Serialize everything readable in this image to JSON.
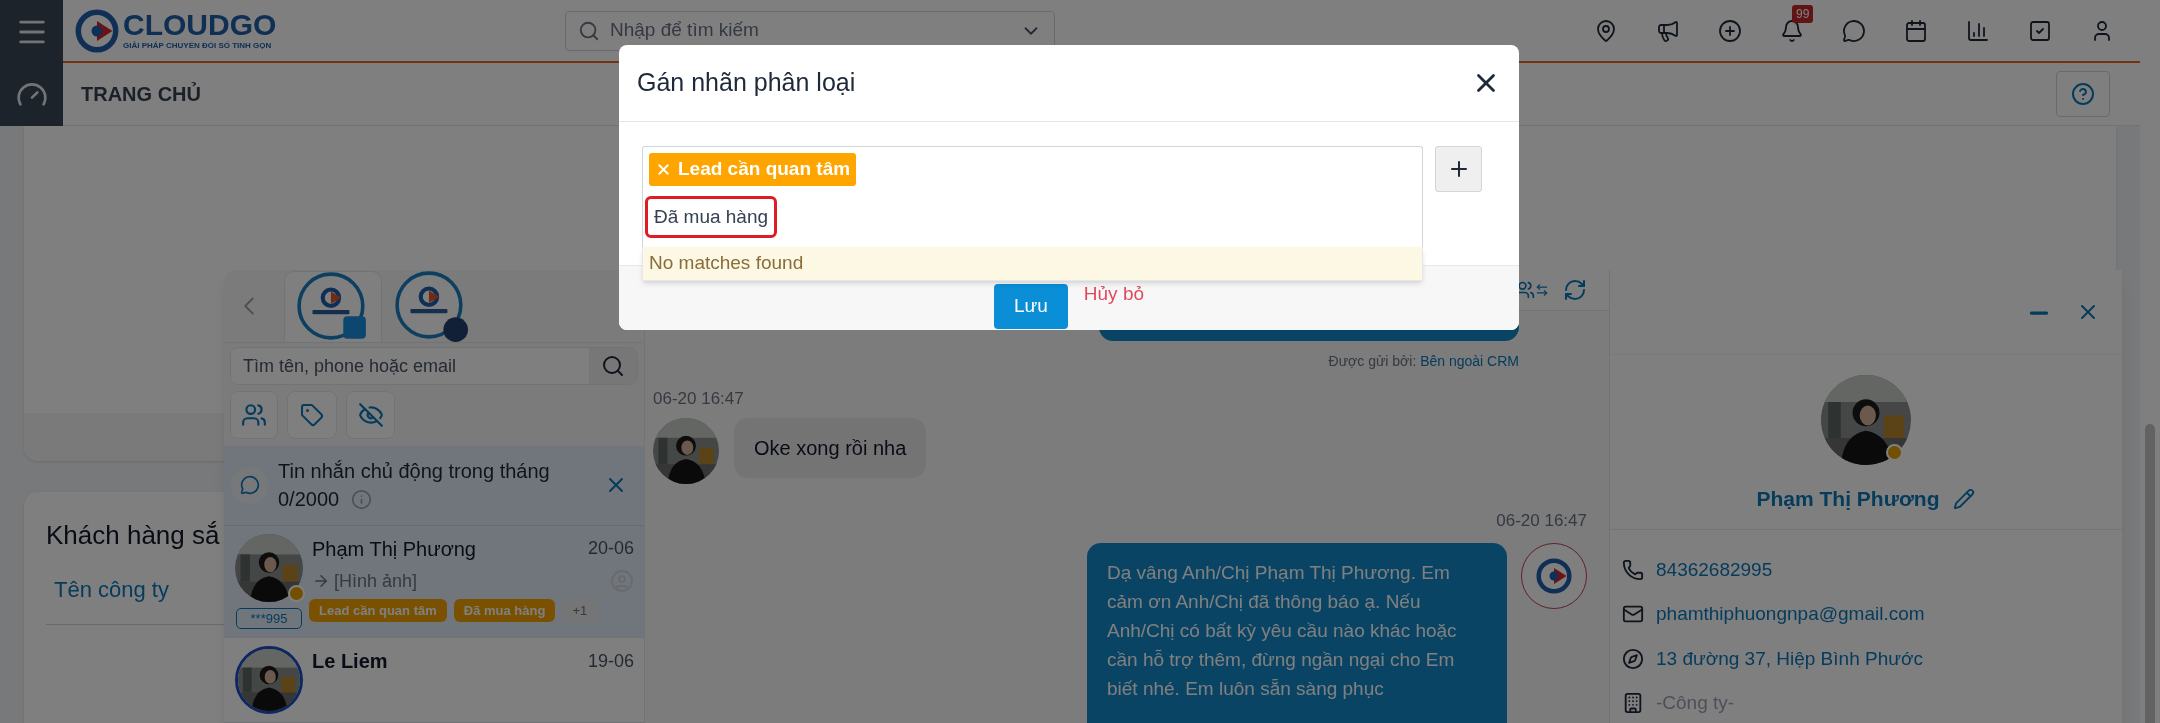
{
  "header": {
    "logo_name": "CLOUDGO",
    "logo_tagline": "GIẢI PHÁP CHUYỂN ĐỔI SỐ TINH GỌN",
    "search_placeholder": "Nhập để tìm kiếm",
    "notification_count": "99"
  },
  "breadcrumb": "TRANG CHỦ",
  "card": {
    "title": "Khách hàng sắ",
    "column": "Tên công ty"
  },
  "chat": {
    "channels": [
      {
        "kind": "zalo",
        "selected": true
      },
      {
        "kind": "facebook",
        "selected": false
      }
    ],
    "search_placeholder": "Tìm tên, phone hoặc email",
    "quota_banner": {
      "text": "Tin nhắn chủ động trong tháng",
      "count": "0/2000"
    },
    "conversations": [
      {
        "name": "Phạm Thị Phương",
        "date": "20-06",
        "preview": "[Hình ảnh]",
        "phone": "***995",
        "tags": [
          "Lead cần quan tâm",
          "Đã mua hàng"
        ],
        "more": "+1",
        "selected": true
      },
      {
        "name": "Le Liem",
        "date": "19-06",
        "selected": false
      }
    ],
    "messages": [
      {
        "kind": "sent_tail",
        "sender_label": "Được gửi bởi:",
        "sender": "Bên ngoài CRM"
      },
      {
        "kind": "received",
        "time": "06-20 16:47",
        "text": "Oke xong rồi nha"
      },
      {
        "kind": "sent",
        "time": "06-20 16:47",
        "text": "Dạ vâng Anh/Chị Phạm Thị Phương. Em cảm ơn Anh/Chị đã thông báo ạ. Nếu Anh/Chị có bất kỳ yêu cầu nào khác hoặc cần hỗ trợ thêm, đừng ngần ngại cho Em biết nhé. Em luôn sẵn sàng phục"
      }
    ],
    "contact": {
      "name": "Phạm Thị Phương",
      "phone": "84362682995",
      "email": "phamthiphuongnpa@gmail.com",
      "address": "13 đường 37, Hiệp Bình Phước",
      "company_placeholder": "-Công ty-"
    }
  },
  "modal": {
    "title": "Gán nhãn phân loại",
    "tags": [
      "Lead cần quan tâm"
    ],
    "input": {
      "value": "Đã mua hàng",
      "highlighted": true
    },
    "dropdown_message": "No matches found",
    "save": "Lưu",
    "cancel": "Hủy bỏ"
  }
}
